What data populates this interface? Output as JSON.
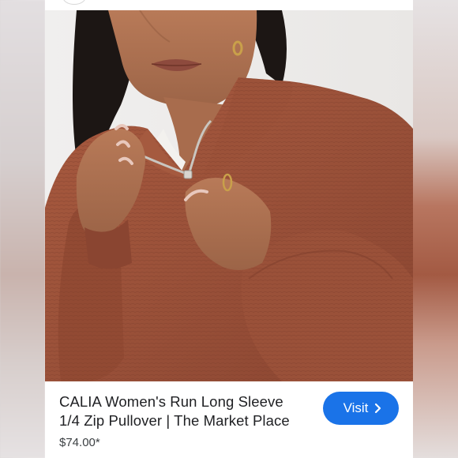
{
  "product": {
    "title_line1": "CALIA Women's Run Long Sleeve",
    "title_line2": "1/4 Zip Pullover | The Market Place",
    "price": "$74.00*",
    "image_icon": "product-photo-sweater"
  },
  "actions": {
    "visit_label": "Visit",
    "visit_icon": "chevron-right-icon"
  },
  "colors": {
    "accent": "#1a73e8",
    "garment": "#9a5139",
    "text": "#202124"
  }
}
